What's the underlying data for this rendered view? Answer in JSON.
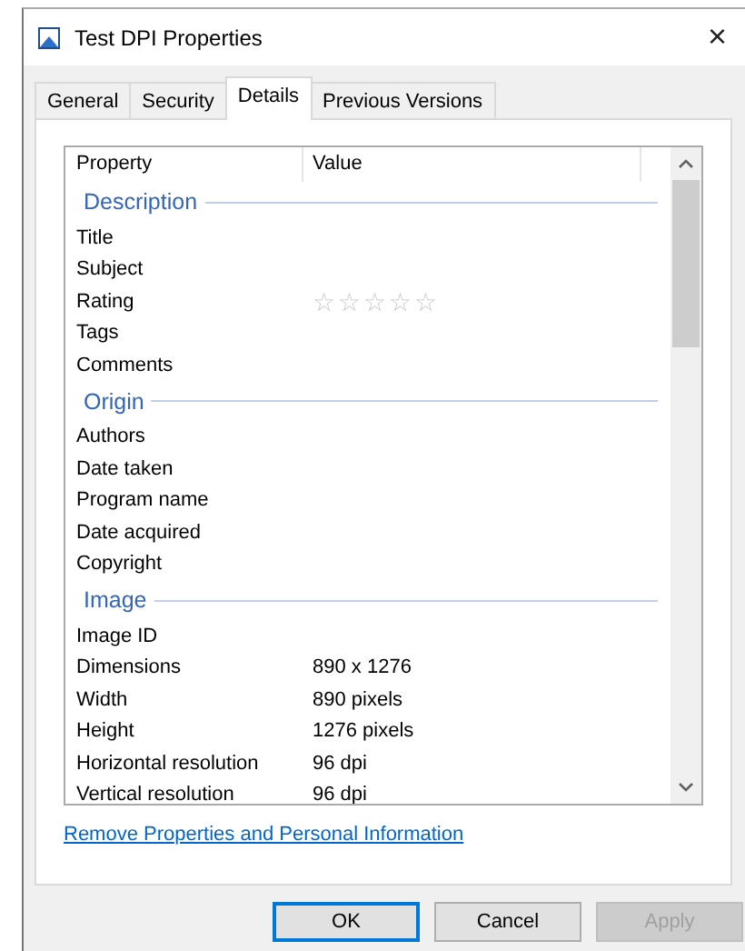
{
  "window": {
    "title": "Test DPI Properties",
    "close": "×"
  },
  "tabs": [
    {
      "label": "General",
      "selected": false
    },
    {
      "label": "Security",
      "selected": false
    },
    {
      "label": "Details",
      "selected": true
    },
    {
      "label": "Previous Versions",
      "selected": false
    }
  ],
  "list": {
    "columns": [
      "Property",
      "Value"
    ],
    "groups": [
      {
        "title": "Description",
        "rows": [
          {
            "kind": "text",
            "property": "Title"
          },
          {
            "kind": "text",
            "property": "Subject"
          },
          {
            "kind": "rating",
            "property": "Rating",
            "stars": 0
          },
          {
            "kind": "text",
            "property": "Tags"
          },
          {
            "kind": "text",
            "property": "Comments"
          }
        ]
      },
      {
        "title": "Origin",
        "rows": [
          {
            "kind": "text",
            "property": "Authors"
          },
          {
            "kind": "text",
            "property": "Date taken"
          },
          {
            "kind": "text",
            "property": "Program name"
          },
          {
            "kind": "text",
            "property": "Date acquired"
          },
          {
            "kind": "text",
            "property": "Copyright"
          }
        ]
      },
      {
        "title": "Image",
        "rows": [
          {
            "kind": "text",
            "property": "Image ID"
          },
          {
            "kind": "text",
            "property": "Dimensions",
            "value": "890 x 1276"
          },
          {
            "kind": "text",
            "property": "Width",
            "value": "890 pixels"
          },
          {
            "kind": "text",
            "property": "Height",
            "value": "1276 pixels"
          },
          {
            "kind": "text",
            "property": "Horizontal resolution",
            "value": "96 dpi"
          },
          {
            "kind": "text",
            "property": "Vertical resolution",
            "value": "96 dpi"
          }
        ]
      }
    ]
  },
  "link": "Remove Properties and Personal Information",
  "buttons": [
    {
      "label": "OK",
      "default": true,
      "disabled": false
    },
    {
      "label": "Cancel",
      "default": false,
      "disabled": false
    },
    {
      "label": "Apply",
      "default": false,
      "disabled": true
    }
  ]
}
